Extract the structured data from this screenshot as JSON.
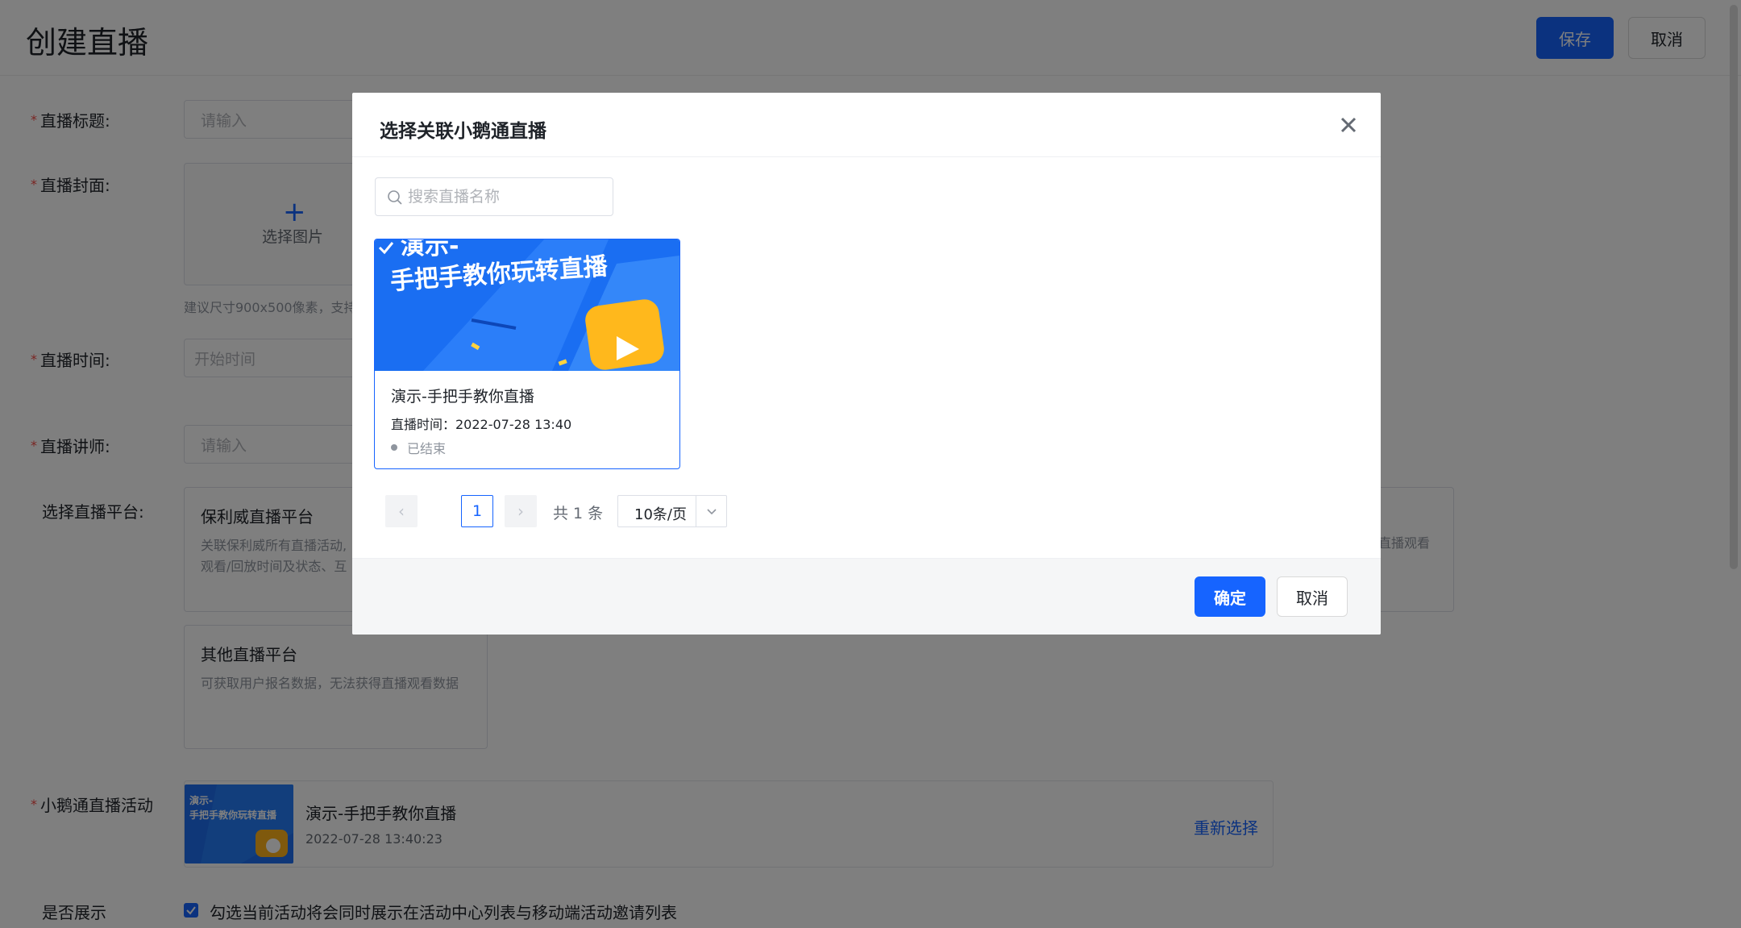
{
  "page": {
    "title": "创建直播",
    "save_label": "保存",
    "cancel_label": "取消"
  },
  "form": {
    "title_label": "直播标题:",
    "title_placeholder": "请输入",
    "cover_label": "直播封面:",
    "cover_upload_text": "选择图片",
    "cover_hint": "建议尺寸900x500像素，支持",
    "time_label": "直播时间:",
    "time_placeholder": "开始时间",
    "lecturer_label": "直播讲师:",
    "lecturer_placeholder": "请输入",
    "platform_label": "选择直播平台:",
    "platform_1_title": "保利威直播平台",
    "platform_1_desc_line1": "关联保利威所有直播活动,",
    "platform_1_desc_line2": "观看/回放时间及状态、互",
    "platform_right_desc": "直播观看",
    "platform_2_title": "其他直播平台",
    "platform_2_desc": "可获取用户报名数据，无法获得直播观看数据",
    "activity_label": "小鹅通直播活动",
    "activity_name": "演示-手把手教你直播",
    "activity_time": "2022-07-28 13:40:23",
    "activity_reselect": "重新选择",
    "show_label": "是否展示",
    "show_text": "勾选当前活动将会同时展示在活动中心列表与移动端活动邀请列表"
  },
  "modal": {
    "title": "选择关联小鹅通直播",
    "search_placeholder": "搜索直播名称",
    "card": {
      "cover_line1": "演示-",
      "cover_line2": "手把手教你玩转直播",
      "name": "演示-手把手教你直播",
      "time": "直播时间：2022-07-28 13:40",
      "status": "已结束"
    },
    "pager": {
      "prev": "‹",
      "next": "›",
      "current": "1",
      "total": "共 1 条",
      "page_size": "10条/页"
    },
    "ok_label": "确定",
    "cancel_label": "取消"
  },
  "thumb": {
    "line1": "演示-",
    "line2": "手把手教你玩转直播"
  },
  "colors": {
    "primary": "#1664ff",
    "required": "#f54a45",
    "overlay": "rgba(0,0,0,0.5)"
  }
}
